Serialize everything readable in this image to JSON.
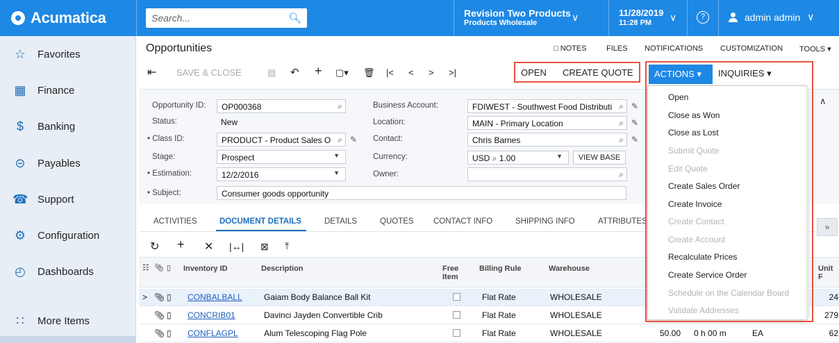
{
  "app": {
    "name": "Acumatica"
  },
  "topbar": {
    "search_placeholder": "Search...",
    "company": "Revision Two Products",
    "branch": "Products Wholesale",
    "date": "11/28/2019",
    "time": "11:28 PM",
    "help_glyph": "?",
    "user": "admin admin"
  },
  "sidebar": {
    "items": [
      {
        "label": "Favorites",
        "icon": "star-icon"
      },
      {
        "label": "Finance",
        "icon": "calculator-icon"
      },
      {
        "label": "Banking",
        "icon": "dollar-icon"
      },
      {
        "label": "Payables",
        "icon": "minus-circle-icon"
      },
      {
        "label": "Support",
        "icon": "headset-icon"
      },
      {
        "label": "Configuration",
        "icon": "gear-icon"
      },
      {
        "label": "Dashboards",
        "icon": "gauge-icon"
      },
      {
        "label": "More Items",
        "icon": "grid-dots-icon"
      }
    ]
  },
  "page": {
    "title": "Opportunities",
    "links": {
      "notes": "NOTES",
      "files": "FILES",
      "notifications": "NOTIFICATIONS",
      "customization": "CUSTOMIZATION",
      "tools": "TOOLS"
    },
    "toolbar": {
      "save_close": "SAVE & CLOSE",
      "open": "OPEN",
      "create_quote": "CREATE QUOTE",
      "actions": "ACTIONS",
      "inquiries": "INQUIRIES"
    }
  },
  "form": {
    "opportunity_id": {
      "label": "Opportunity ID:",
      "value": "OP000368"
    },
    "status": {
      "label": "Status:",
      "value": "New"
    },
    "class_id": {
      "label": "• Class ID:",
      "value": "PRODUCT - Product Sales O"
    },
    "stage": {
      "label": "Stage:",
      "value": "Prospect"
    },
    "estimation": {
      "label": "• Estimation:",
      "value": "12/2/2016"
    },
    "subject": {
      "label": "• Subject:",
      "value": "Consumer goods opportunity"
    },
    "business_account": {
      "label": "Business Account:",
      "value": "FDIWEST - Southwest Food Distributi"
    },
    "location": {
      "label": "Location:",
      "value": "MAIN - Primary Location"
    },
    "contact": {
      "label": "Contact:",
      "value": "Chris Barnes"
    },
    "currency": {
      "label": "Currency:",
      "value": "USD",
      "rate": "1.00",
      "view_base": "VIEW BASE"
    },
    "owner": {
      "label": "Owner:",
      "value": ""
    }
  },
  "tabs": [
    "ACTIVITIES",
    "DOCUMENT DETAILS",
    "DETAILS",
    "QUOTES",
    "CONTACT INFO",
    "SHIPPING INFO",
    "ATTRIBUTES"
  ],
  "grid": {
    "headers": {
      "inventory_id": "Inventory ID",
      "description": "Description",
      "free_item": "Free Item",
      "billing_rule": "Billing Rule",
      "warehouse": "Warehouse",
      "unit_price": "Unit F"
    },
    "rows": [
      {
        "inventory_id": "CONBALBALL",
        "description": "Gaiam Body Balance Ball Kit",
        "billing_rule": "Flat Rate",
        "warehouse": "WHOLESALE",
        "qty": "",
        "time": "",
        "uom": "",
        "price": "24"
      },
      {
        "inventory_id": "CONCRIB01",
        "description": "Davinci Jayden Convertible Crib",
        "billing_rule": "Flat Rate",
        "warehouse": "WHOLESALE",
        "qty": "",
        "time": "",
        "uom": "",
        "price": "279"
      },
      {
        "inventory_id": "CONFLAGPL",
        "description": "Alum Telescoping Flag Pole",
        "billing_rule": "Flat Rate",
        "warehouse": "WHOLESALE",
        "qty": "50.00",
        "time": "0 h 00 m",
        "uom": "EA",
        "price": "62"
      }
    ]
  },
  "actions_menu": [
    {
      "label": "Open",
      "enabled": true
    },
    {
      "label": "Close as Won",
      "enabled": true
    },
    {
      "label": "Close as Lost",
      "enabled": true
    },
    {
      "label": "Submit Quote",
      "enabled": false
    },
    {
      "label": "Edit Quote",
      "enabled": false
    },
    {
      "label": "Create Sales Order",
      "enabled": true
    },
    {
      "label": "Create Invoice",
      "enabled": true
    },
    {
      "label": "Create Contact",
      "enabled": false
    },
    {
      "label": "Create Account",
      "enabled": false
    },
    {
      "label": "Recalculate Prices",
      "enabled": true
    },
    {
      "label": "Create Service Order",
      "enabled": true
    },
    {
      "label": "Schedule on the Calendar Board",
      "enabled": false
    },
    {
      "label": "Validate Addresses",
      "enabled": false
    }
  ],
  "colors": {
    "brand": "#1E88E5",
    "highlight": "#E8523D",
    "link": "#1E5FBF"
  }
}
